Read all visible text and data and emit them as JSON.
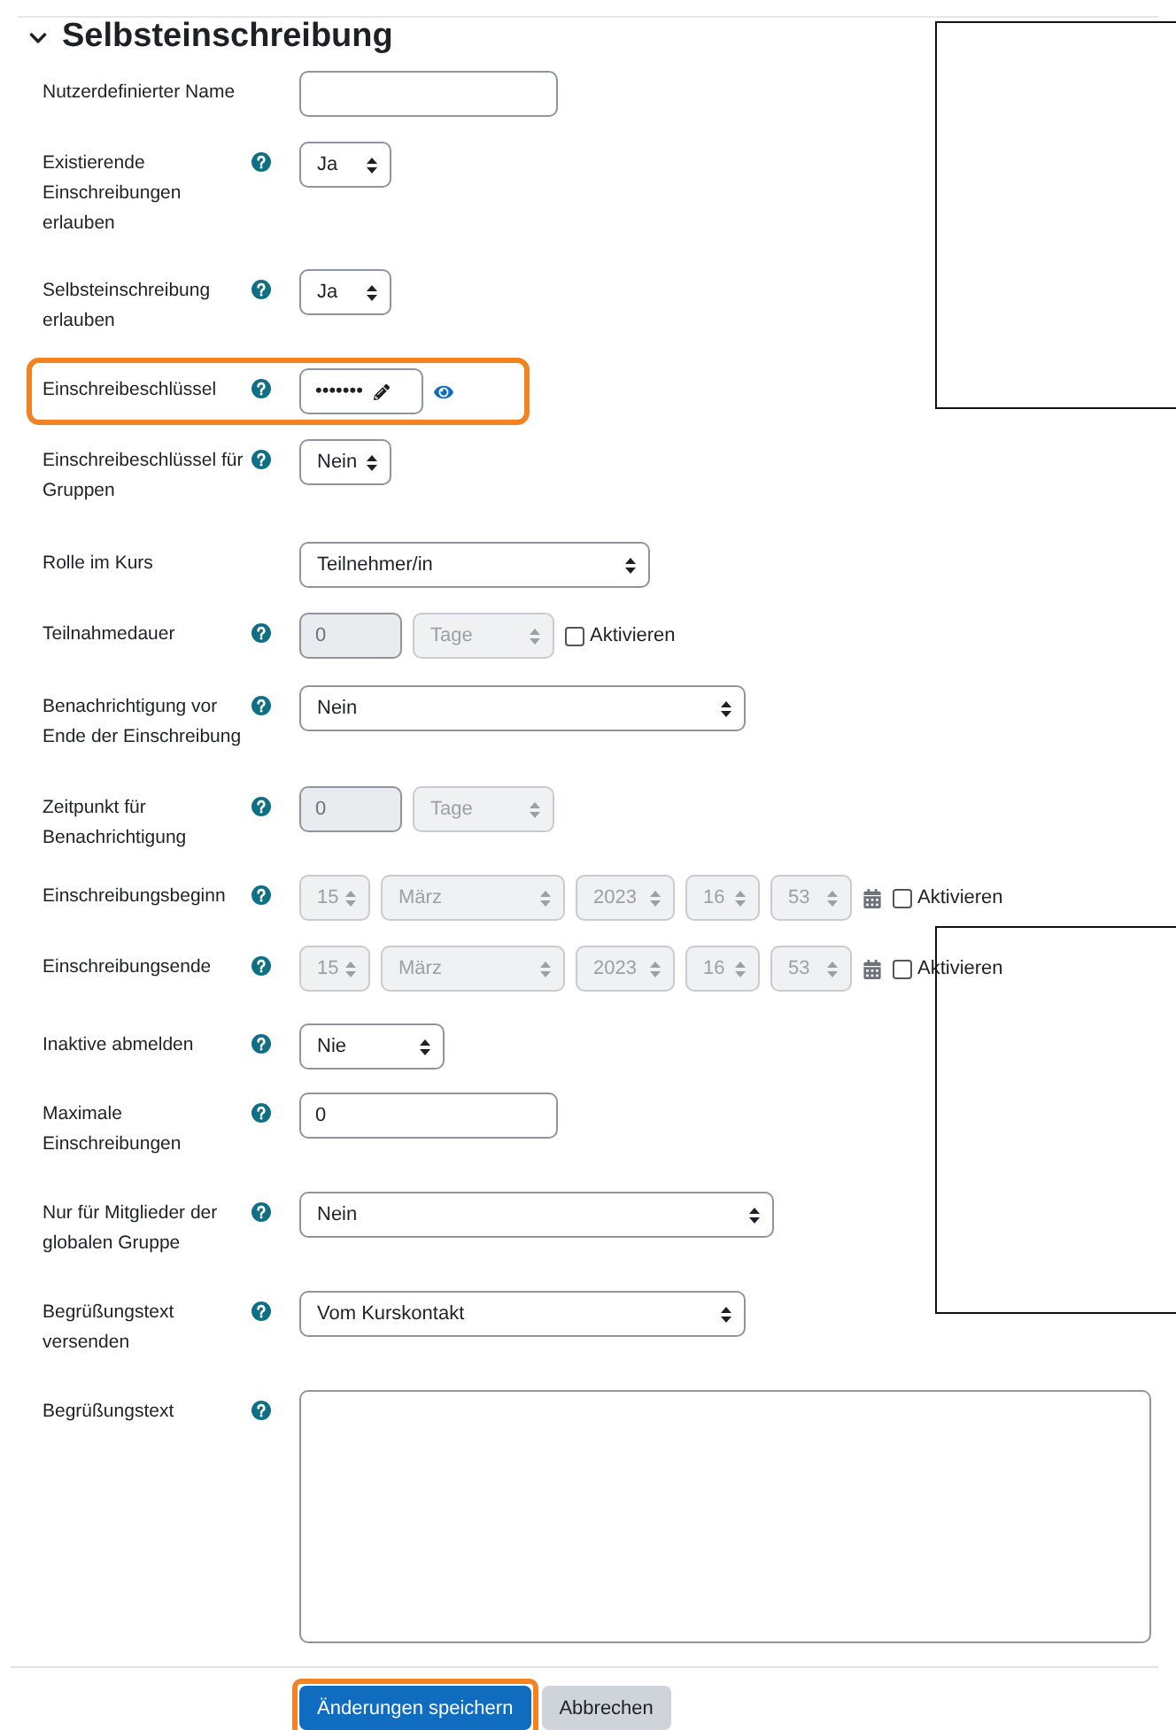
{
  "section": {
    "title": "Selbsteinschreibung",
    "expanded": true
  },
  "rows": [
    {
      "label": "Nutzerdefinierter Name",
      "help": false,
      "kind": "text",
      "highlighted": false
    },
    {
      "label": "Existierende Einschreibungen erlauben",
      "help": true,
      "kind": "select",
      "value": "Ja",
      "highlighted": false
    },
    {
      "label": "Selbsteinschreibung erlauben",
      "help": true,
      "kind": "select",
      "value": "Ja",
      "highlighted": false
    },
    {
      "label": "Einschreibeschlüssel",
      "help": true,
      "kind": "password",
      "value": "•••••••",
      "highlighted": true
    },
    {
      "label": "Einschreibeschlüssel für Gruppen",
      "help": true,
      "kind": "select",
      "value": "Nein",
      "highlighted": false
    },
    {
      "label": "Rolle im Kurs",
      "help": false,
      "kind": "select",
      "value": "Teilnehmer/in",
      "highlighted": false
    },
    {
      "label": "Teilnahmedauer",
      "help": true,
      "kind": "duration",
      "number": "0",
      "unit": "Tage",
      "disabled": true,
      "checkbox": {
        "label": "Aktivieren",
        "checked": false
      },
      "highlighted": false
    },
    {
      "label": "Benachrichtigung vor Ende der Einschreibung",
      "help": true,
      "kind": "select",
      "value": "Nein",
      "highlighted": false
    },
    {
      "label": "Zeitpunkt für Benachrichtigung",
      "help": true,
      "kind": "duration",
      "number": "0",
      "unit": "Tage",
      "disabled": true,
      "highlighted": false
    },
    {
      "label": "Einschreibungsbeginn",
      "help": true,
      "kind": "datetime",
      "parts": [
        "15",
        "März",
        "2023",
        "16",
        "53"
      ],
      "disabled": true,
      "checkbox": {
        "label": "Aktivieren",
        "checked": false
      },
      "highlighted": false
    },
    {
      "label": "Einschreibungsende",
      "help": true,
      "kind": "datetime",
      "parts": [
        "15",
        "März",
        "2023",
        "16",
        "53"
      ],
      "disabled": true,
      "checkbox": {
        "label": "Aktivieren",
        "checked": false
      },
      "highlighted": false
    },
    {
      "label": "Inaktive abmelden",
      "help": true,
      "kind": "select",
      "value": "Nie",
      "highlighted": false
    },
    {
      "label": "Maximale Einschreibungen",
      "help": true,
      "kind": "text",
      "value": "0",
      "highlighted": false
    },
    {
      "label": "Nur für Mitglieder der globalen Gruppe",
      "help": true,
      "kind": "select",
      "value": "Nein",
      "highlighted": false
    },
    {
      "label": "Begrüßungstext versenden",
      "help": true,
      "kind": "select",
      "value": "Vom Kurskontakt",
      "highlighted": false
    },
    {
      "label": "Begrüßungstext",
      "help": true,
      "kind": "textarea",
      "highlighted": false
    }
  ],
  "buttons": [
    {
      "label": "Änderungen speichern",
      "primary": true,
      "highlighted": true
    },
    {
      "label": "Abbrechen",
      "primary": false,
      "highlighted": false
    }
  ],
  "overlays": [
    {
      "kind": "blank-frame"
    },
    {
      "kind": "blank-frame"
    }
  ]
}
